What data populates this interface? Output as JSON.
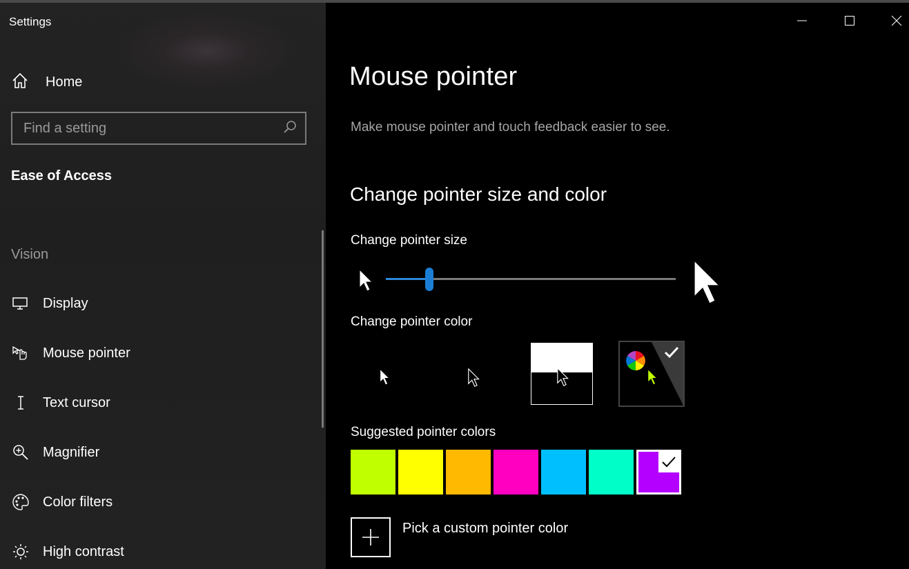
{
  "window": {
    "title": "Settings",
    "controls": [
      "minimize",
      "maximize",
      "close"
    ]
  },
  "sidebar": {
    "home_label": "Home",
    "search_placeholder": "Find a setting",
    "section_title": "Ease of Access",
    "group_label": "Vision",
    "items": [
      {
        "label": "Display",
        "icon": "monitor-icon"
      },
      {
        "label": "Mouse pointer",
        "icon": "hand-pointer-icon"
      },
      {
        "label": "Text cursor",
        "icon": "text-cursor-icon"
      },
      {
        "label": "Magnifier",
        "icon": "magnifier-icon"
      },
      {
        "label": "Color filters",
        "icon": "palette-icon"
      },
      {
        "label": "High contrast",
        "icon": "sun-icon"
      }
    ]
  },
  "main": {
    "title": "Mouse pointer",
    "description": "Make mouse pointer and touch feedback easier to see.",
    "section_title": "Change pointer size and color",
    "size_label": "Change pointer size",
    "size_value": 0.15,
    "color_label": "Change pointer color",
    "color_options": [
      "white",
      "black",
      "inverted",
      "custom"
    ],
    "selected_color_option": "custom",
    "suggested_label": "Suggested pointer colors",
    "suggested_colors": [
      "#BFFF00",
      "#FFFF00",
      "#FFB900",
      "#FF00C0",
      "#00BFFF",
      "#00FFC8",
      "#B400FF"
    ],
    "selected_suggested_index": 6,
    "custom_color_label": "Pick a custom pointer color"
  },
  "colors": {
    "accent": "#1A7FD4",
    "custom_pointer": "#BFFF00"
  }
}
